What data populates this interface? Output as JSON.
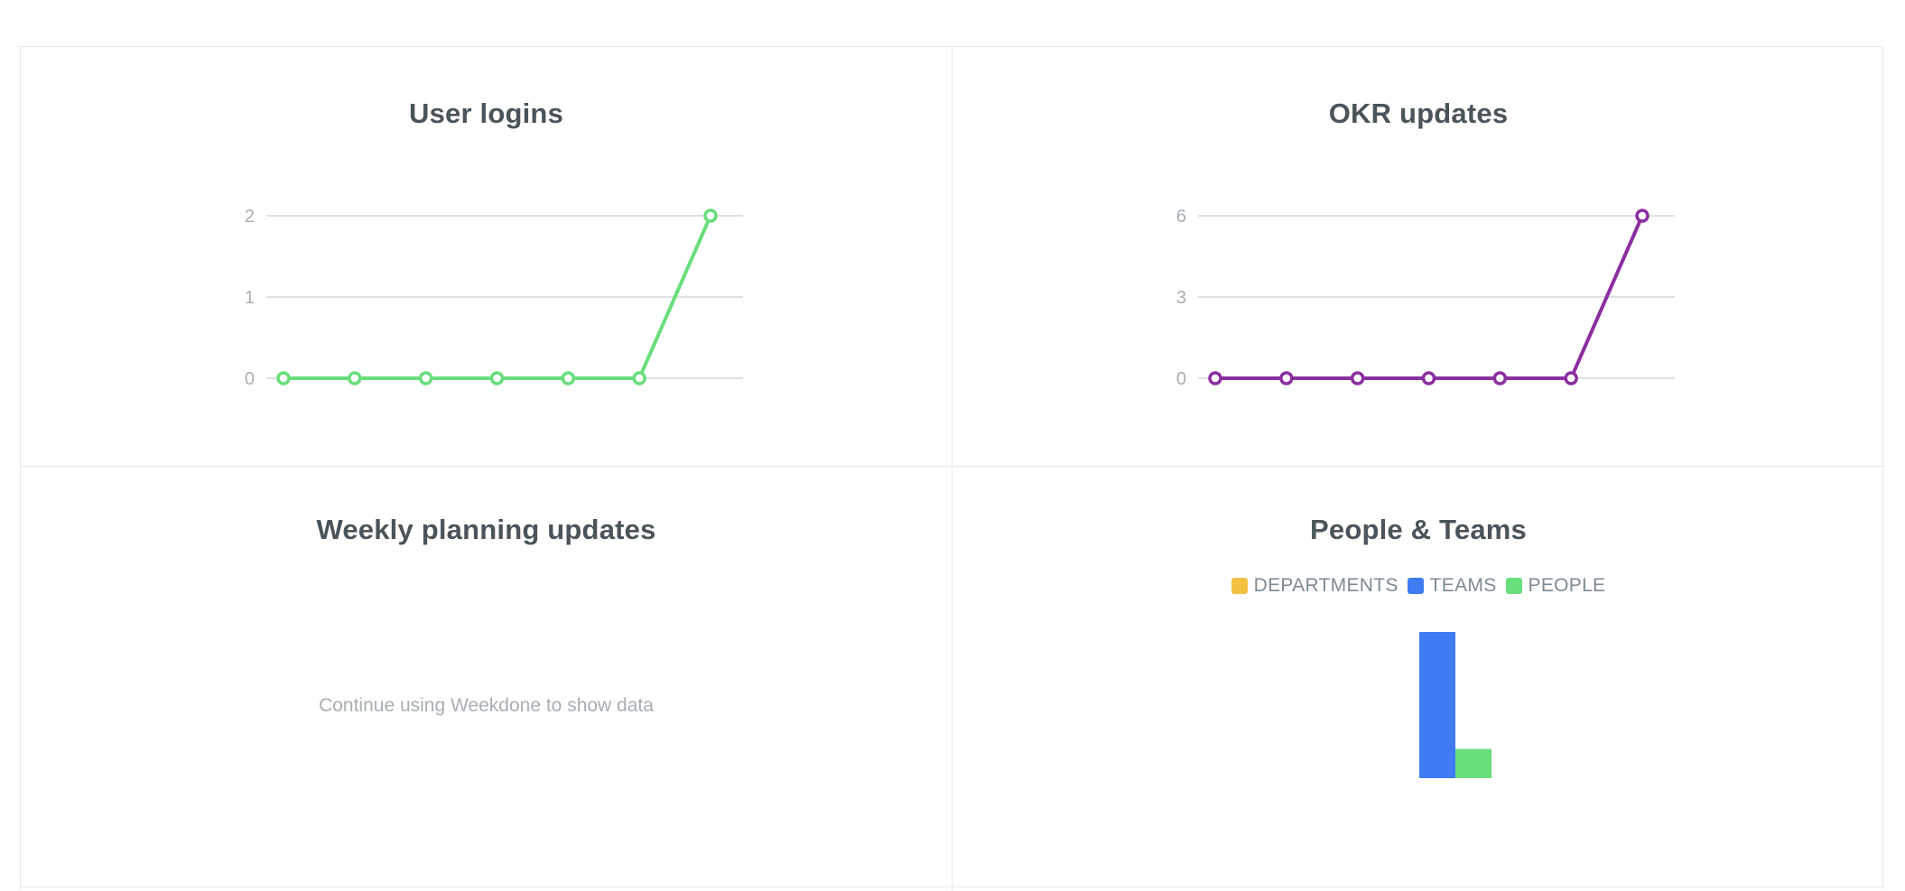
{
  "panels": {
    "user_logins": {
      "title": "User logins",
      "color": "#68de7c"
    },
    "okr_updates": {
      "title": "OKR updates",
      "color": "#8b2fa0"
    },
    "weekly_planning": {
      "title": "Weekly planning updates",
      "empty_message": "Continue using Weekdone to show data"
    },
    "people_teams": {
      "title": "People & Teams",
      "legend": [
        {
          "label": "DEPARTMENTS",
          "color": "#f2c043"
        },
        {
          "label": "TEAMS",
          "color": "#3f7cf4"
        },
        {
          "label": "PEOPLE",
          "color": "#68de7c"
        }
      ]
    }
  },
  "chart_data": [
    {
      "type": "line",
      "title": "User logins",
      "x": [
        1,
        2,
        3,
        4,
        5,
        6,
        7
      ],
      "series": [
        {
          "values": [
            0,
            0,
            0,
            0,
            0,
            0,
            2
          ]
        }
      ],
      "yticks": [
        "0",
        "1",
        "2"
      ],
      "ylim": [
        0,
        2
      ],
      "grid": true
    },
    {
      "type": "line",
      "title": "OKR updates",
      "x": [
        1,
        2,
        3,
        4,
        5,
        6,
        7
      ],
      "series": [
        {
          "values": [
            0,
            0,
            0,
            0,
            0,
            0,
            6
          ]
        }
      ],
      "yticks": [
        "0",
        "3",
        "6"
      ],
      "ylim": [
        0,
        6
      ],
      "grid": true
    },
    {
      "type": "bar",
      "title": "People & Teams",
      "categories": [
        "DEPARTMENTS",
        "TEAMS",
        "PEOPLE"
      ],
      "values": [
        0,
        5,
        1
      ],
      "legend_position": "top"
    }
  ]
}
